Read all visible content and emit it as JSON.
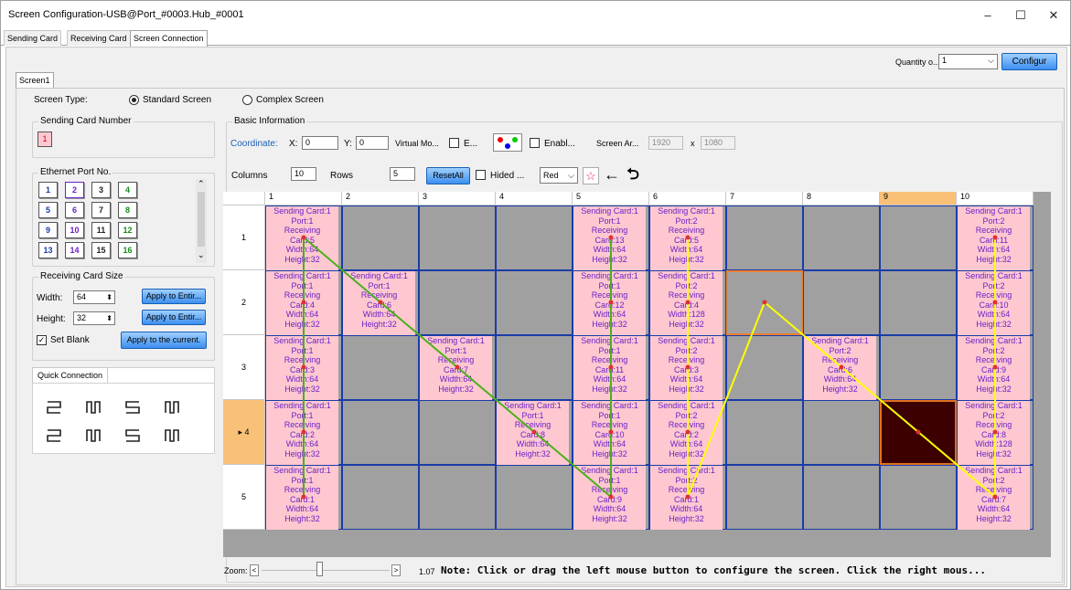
{
  "window": {
    "title": "Screen Configuration-USB@Port_#0003.Hub_#0001",
    "minimize": "–",
    "maximize": "☐",
    "close": "✕"
  },
  "tabs": [
    "Sending Card",
    "Receiving Card",
    "Screen Connection"
  ],
  "quantity": {
    "label": "Quantity o...",
    "value": "1",
    "configure": "Configur"
  },
  "screen_tab": "Screen1",
  "screen_type": {
    "label": "Screen Type:",
    "standard": "Standard Screen",
    "complex": "Complex Screen"
  },
  "sending_card": {
    "title": "Sending Card Number",
    "value": "1"
  },
  "ethernet": {
    "title": "Ethernet Port No.",
    "ports": [
      "1",
      "2",
      "3",
      "4",
      "5",
      "6",
      "7",
      "8",
      "9",
      "10",
      "11",
      "12",
      "13",
      "14",
      "15",
      "16"
    ]
  },
  "rcs": {
    "title": "Receiving Card Size",
    "width_label": "Width:",
    "width": "64",
    "height_label": "Height:",
    "height": "32",
    "apply_w": "Apply to Entir...",
    "apply_h": "Apply to Entir...",
    "set_blank": "Set Blank",
    "apply_current": "Apply to the current."
  },
  "quick": {
    "title": "Quick Connection"
  },
  "basic": {
    "title": "Basic Information",
    "coordinate": "Coordinate:",
    "x_label": "X:",
    "x": "0",
    "y_label": "Y:",
    "y": "0",
    "virtual": "Virtual Mo...",
    "e_label": "E...",
    "enable": "Enabl...",
    "screen_area": "Screen Ar...",
    "sa_w": "1920",
    "sa_x": "x",
    "sa_h": "1080",
    "columns_label": "Columns",
    "columns": "10",
    "rows_label": "Rows",
    "rows": "5",
    "reset_all": "ResetAll",
    "hided": "Hided ...",
    "color": "Red"
  },
  "grid": {
    "col_headers": [
      "1",
      "2",
      "3",
      "4",
      "5",
      "6",
      "7",
      "8",
      "9",
      "10"
    ],
    "row_headers": [
      "1",
      "2",
      "3",
      "4",
      "5"
    ],
    "selected_col": 9,
    "selected_row": 4,
    "cells": [
      {
        "r": 1,
        "c": 1,
        "port": "Port:1",
        "card": "Card:5",
        "width": "Width:64"
      },
      {
        "r": 1,
        "c": 5,
        "port": "Port:1",
        "card": "Card:13",
        "width": "Width:64"
      },
      {
        "r": 1,
        "c": 6,
        "port": "Port:2",
        "card": "Card:5",
        "width": "Width:64"
      },
      {
        "r": 1,
        "c": 10,
        "port": "Port:2",
        "card": "Card:11",
        "width": "Width:64"
      },
      {
        "r": 2,
        "c": 1,
        "port": "Port:1",
        "card": "Card:4",
        "width": "Width:64"
      },
      {
        "r": 2,
        "c": 2,
        "port": "Port:1",
        "card": "Card:6",
        "width": "Width:64"
      },
      {
        "r": 2,
        "c": 5,
        "port": "Port:1",
        "card": "Card:12",
        "width": "Width:64"
      },
      {
        "r": 2,
        "c": 6,
        "port": "Port:2",
        "card": "Card:4",
        "width": "Width:128"
      },
      {
        "r": 2,
        "c": 10,
        "port": "Port:2",
        "card": "Card:10",
        "width": "Width:64"
      },
      {
        "r": 3,
        "c": 1,
        "port": "Port:1",
        "card": "Card:3",
        "width": "Width:64"
      },
      {
        "r": 3,
        "c": 3,
        "port": "Port:1",
        "card": "Card:7",
        "width": "Width:64"
      },
      {
        "r": 3,
        "c": 5,
        "port": "Port:1",
        "card": "Card:11",
        "width": "Width:64"
      },
      {
        "r": 3,
        "c": 6,
        "port": "Port:2",
        "card": "Card:3",
        "width": "Width:64"
      },
      {
        "r": 3,
        "c": 8,
        "port": "Port:2",
        "card": "Card:6",
        "width": "Width:64"
      },
      {
        "r": 3,
        "c": 10,
        "port": "Port:2",
        "card": "Card:9",
        "width": "Width:64"
      },
      {
        "r": 4,
        "c": 1,
        "port": "Port:1",
        "card": "Card:2",
        "width": "Width:64"
      },
      {
        "r": 4,
        "c": 4,
        "port": "Port:1",
        "card": "Card:8",
        "width": "Width:64"
      },
      {
        "r": 4,
        "c": 5,
        "port": "Port:1",
        "card": "Card:10",
        "width": "Width:64"
      },
      {
        "r": 4,
        "c": 6,
        "port": "Port:2",
        "card": "Card:2",
        "width": "Width:64"
      },
      {
        "r": 4,
        "c": 10,
        "port": "Port:2",
        "card": "Card:8",
        "width": "Width:128"
      },
      {
        "r": 5,
        "c": 1,
        "port": "Port:1",
        "card": "Card:1",
        "width": "Width:64"
      },
      {
        "r": 5,
        "c": 5,
        "port": "Port:1",
        "card": "Card:9",
        "width": "Width:64"
      },
      {
        "r": 5,
        "c": 6,
        "port": "Port:2",
        "card": "Card:1",
        "width": "Width:64"
      },
      {
        "r": 5,
        "c": 10,
        "port": "Port:2",
        "card": "Card:7",
        "width": "Width:64"
      }
    ],
    "card_title": "Sending Card:1",
    "receiving": "Receiving",
    "height_partial": "Height:32"
  },
  "zoom": {
    "label": "Zoom:",
    "value": "1.07",
    "left": "<",
    "right": ">"
  },
  "note": "Note: Click or drag the left mouse button to configure the screen. Click the right mous...",
  "colors": {
    "card_bg": "#ffc8d0",
    "card_text": "#6b22c8",
    "grid_line": "#1a3ca8",
    "header_sel": "#f9c078",
    "port1_line": "#4caf1c",
    "port2_line": "#ffff00",
    "sel_cell": "#3c0000"
  }
}
